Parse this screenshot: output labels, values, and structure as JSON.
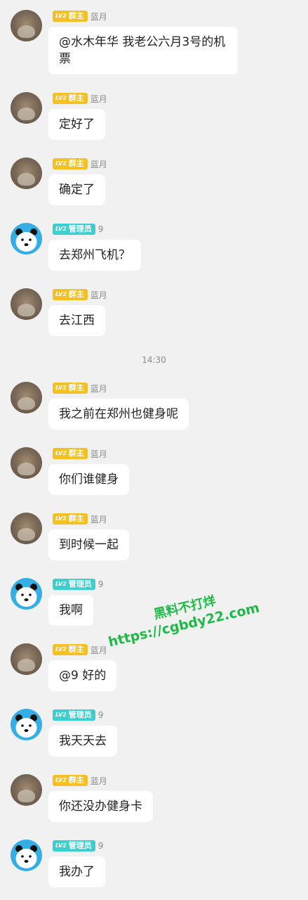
{
  "messages": [
    {
      "role": "owner",
      "badge_level": "LV2",
      "badge_text": "群主",
      "nick": "蓝月",
      "text": "@水木年华 我老公六月3号的机票"
    },
    {
      "role": "owner",
      "badge_level": "LV2",
      "badge_text": "群主",
      "nick": "蓝月",
      "text": "定好了"
    },
    {
      "role": "owner",
      "badge_level": "LV2",
      "badge_text": "群主",
      "nick": "蓝月",
      "text": "确定了"
    },
    {
      "role": "admin",
      "badge_level": "LV2",
      "badge_text": "管理员",
      "nick": "9",
      "text": "去郑州飞机？"
    },
    {
      "role": "owner",
      "badge_level": "LV2",
      "badge_text": "群主",
      "nick": "蓝月",
      "text": "去江西"
    },
    {
      "role": "owner",
      "badge_level": "LV2",
      "badge_text": "群主",
      "nick": "蓝月",
      "text": "我之前在郑州也健身呢"
    },
    {
      "role": "owner",
      "badge_level": "LV2",
      "badge_text": "群主",
      "nick": "蓝月",
      "text": "你们谁健身"
    },
    {
      "role": "owner",
      "badge_level": "LV2",
      "badge_text": "群主",
      "nick": "蓝月",
      "text": "到时候一起"
    },
    {
      "role": "admin",
      "badge_level": "LV2",
      "badge_text": "管理员",
      "nick": "9",
      "text": "我啊"
    },
    {
      "role": "owner",
      "badge_level": "LV2",
      "badge_text": "群主",
      "nick": "蓝月",
      "text": "@9 好的"
    },
    {
      "role": "admin",
      "badge_level": "LV2",
      "badge_text": "管理员",
      "nick": "9",
      "text": "我天天去"
    },
    {
      "role": "owner",
      "badge_level": "LV2",
      "badge_text": "群主",
      "nick": "蓝月",
      "text": "你还没办健身卡"
    },
    {
      "role": "admin",
      "badge_level": "LV2",
      "badge_text": "管理员",
      "nick": "9",
      "text": "我办了"
    }
  ],
  "timestamp": "14:30",
  "watermark": {
    "line1": "黑料不打烊",
    "line2": "https://cgbdy22.com"
  }
}
